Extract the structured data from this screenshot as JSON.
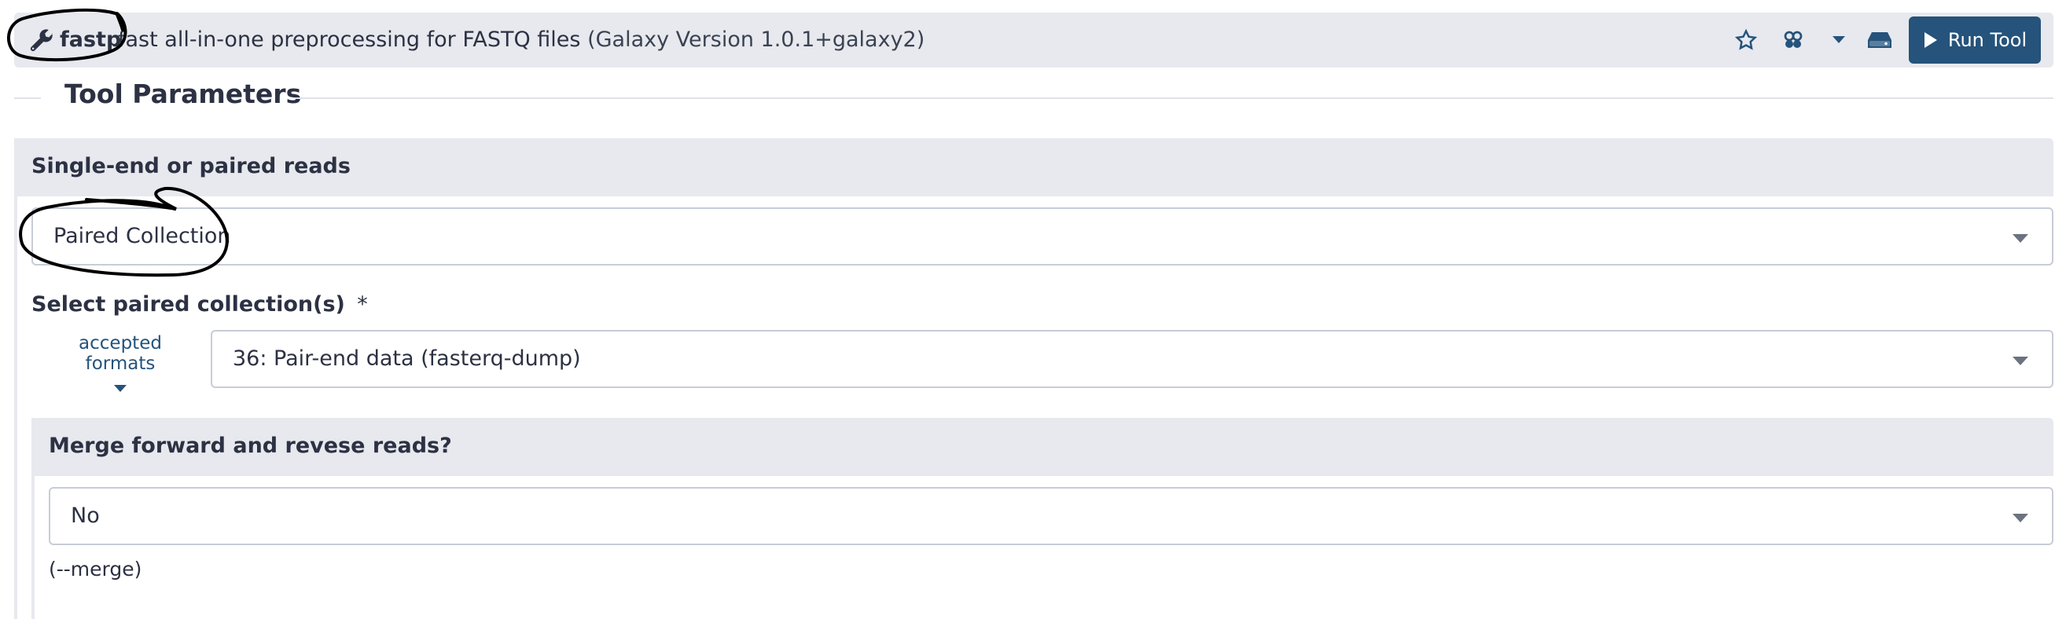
{
  "header": {
    "wrench_icon": "wrench-icon",
    "tool_name": "fastp",
    "tool_description": "fast all-in-one preprocessing for FASTQ files",
    "tool_version": "(Galaxy Version 1.0.1+galaxy2)",
    "icons": [
      "star-icon",
      "share-icon",
      "chevron-down-icon",
      "hard-drive-icon"
    ],
    "run_button_label": "Run Tool",
    "run_button_color": "#25537b"
  },
  "section": {
    "title": "Tool Parameters"
  },
  "reads": {
    "label": "Single-end or paired reads",
    "selected": "Paired Collection"
  },
  "paired": {
    "label": "Select paired collection(s)",
    "required_marker": "*",
    "accepted_formats": "accepted formats",
    "selected": "36: Pair-end data (fasterq-dump)"
  },
  "merge": {
    "label": "Merge forward and revese reads?",
    "selected": "No",
    "help": "(--merge)"
  },
  "colors": {
    "header_bg": "#e7e9ee",
    "text": "#2c3143",
    "accent": "#25537b"
  }
}
